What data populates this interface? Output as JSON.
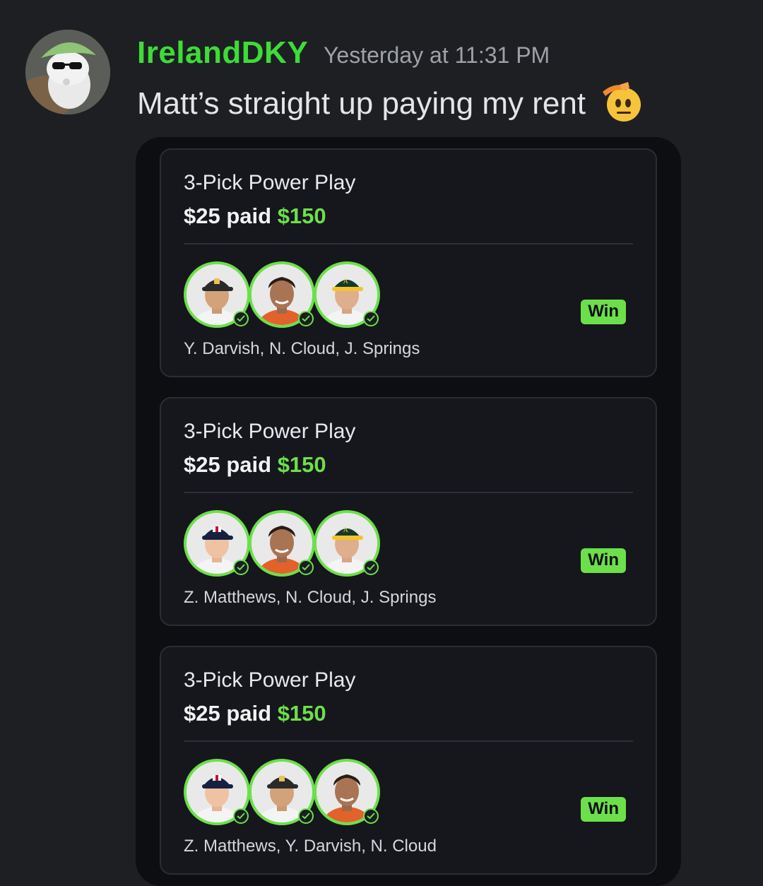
{
  "message": {
    "username": "IrelandDKY",
    "timestamp": "Yesterday at 11:31 PM",
    "text": "Matt’s straight up paying my rent",
    "emoji": "saluting-face-emoji"
  },
  "colors": {
    "username": "#3ddc38",
    "accent_green": "#6ce04a",
    "background": "#1e1f23",
    "card_bg": "#15171c"
  },
  "cards": [
    {
      "title": "3-Pick Power Play",
      "paid": "$25 paid",
      "payout": "$150",
      "result": "Win",
      "players": "Y. Darvish, N. Cloud, J. Springs",
      "caps": [
        "padres",
        "none",
        "athletics"
      ]
    },
    {
      "title": "3-Pick Power Play",
      "paid": "$25 paid",
      "payout": "$150",
      "result": "Win",
      "players": "Z. Matthews, N. Cloud, J. Springs",
      "caps": [
        "twins",
        "none",
        "athletics"
      ]
    },
    {
      "title": "3-Pick Power Play",
      "paid": "$25 paid",
      "payout": "$150",
      "result": "Win",
      "players": "Z. Matthews, Y. Darvish, N. Cloud",
      "caps": [
        "twins",
        "padres",
        "none"
      ]
    }
  ]
}
